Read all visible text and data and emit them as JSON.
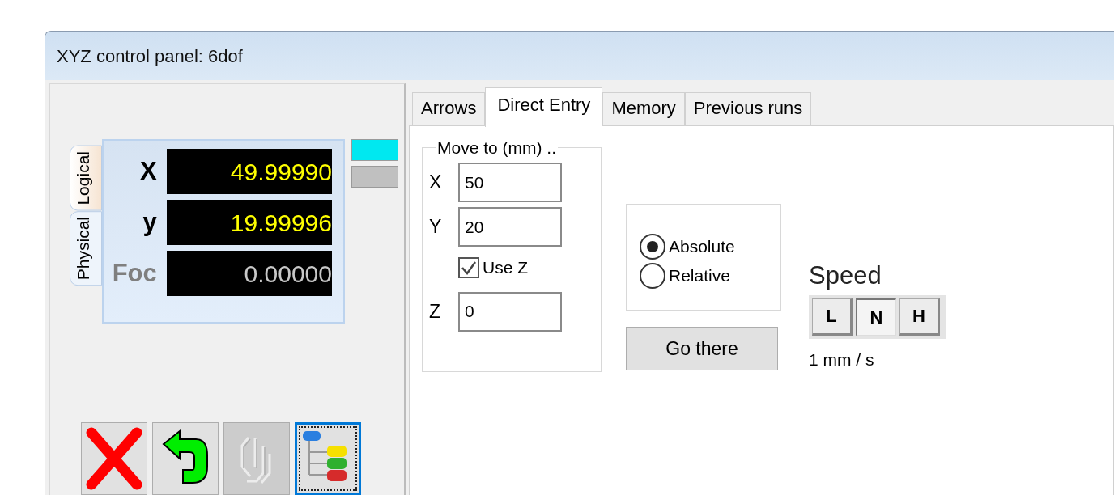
{
  "window": {
    "title": "XYZ control panel: 6dof"
  },
  "readout": {
    "tabs": [
      {
        "label": "Logical",
        "selected": true
      },
      {
        "label": "Physical",
        "selected": false
      }
    ],
    "axes": [
      {
        "label": "X",
        "value": "49.99990",
        "disabled": false
      },
      {
        "label": "y",
        "value": "19.99996",
        "disabled": false
      },
      {
        "label": "Foc",
        "value": "0.00000",
        "disabled": true
      }
    ],
    "indicators": [
      {
        "color": "#00e8f0"
      },
      {
        "color": "#c0c0c0"
      }
    ]
  },
  "toolbar": [
    {
      "kind": "cancel",
      "disabled": false,
      "selected": false
    },
    {
      "kind": "return",
      "disabled": false,
      "selected": false
    },
    {
      "kind": "clip",
      "disabled": true,
      "selected": false
    },
    {
      "kind": "tree",
      "disabled": false,
      "selected": true
    }
  ],
  "tabs": [
    {
      "label": "Arrows",
      "selected": false
    },
    {
      "label": "Direct Entry",
      "selected": true
    },
    {
      "label": "Memory",
      "selected": false
    },
    {
      "label": "Previous runs",
      "selected": false
    }
  ],
  "move_to": {
    "legend": "Move to (mm) ..",
    "fields": [
      {
        "label": "X",
        "value": "50"
      },
      {
        "label": "Y",
        "value": "20"
      }
    ],
    "use_z": {
      "label": "Use Z",
      "checked": true
    },
    "z": {
      "label": "Z",
      "value": "0"
    }
  },
  "mode": [
    {
      "label": "Absolute",
      "selected": true
    },
    {
      "label": "Relative",
      "selected": false
    }
  ],
  "go_button": "Go there",
  "speed": {
    "title": "Speed",
    "options": [
      {
        "label": "L",
        "selected": false
      },
      {
        "label": "N",
        "selected": true
      },
      {
        "label": "H",
        "selected": false
      }
    ],
    "reading": "1 mm / s"
  }
}
